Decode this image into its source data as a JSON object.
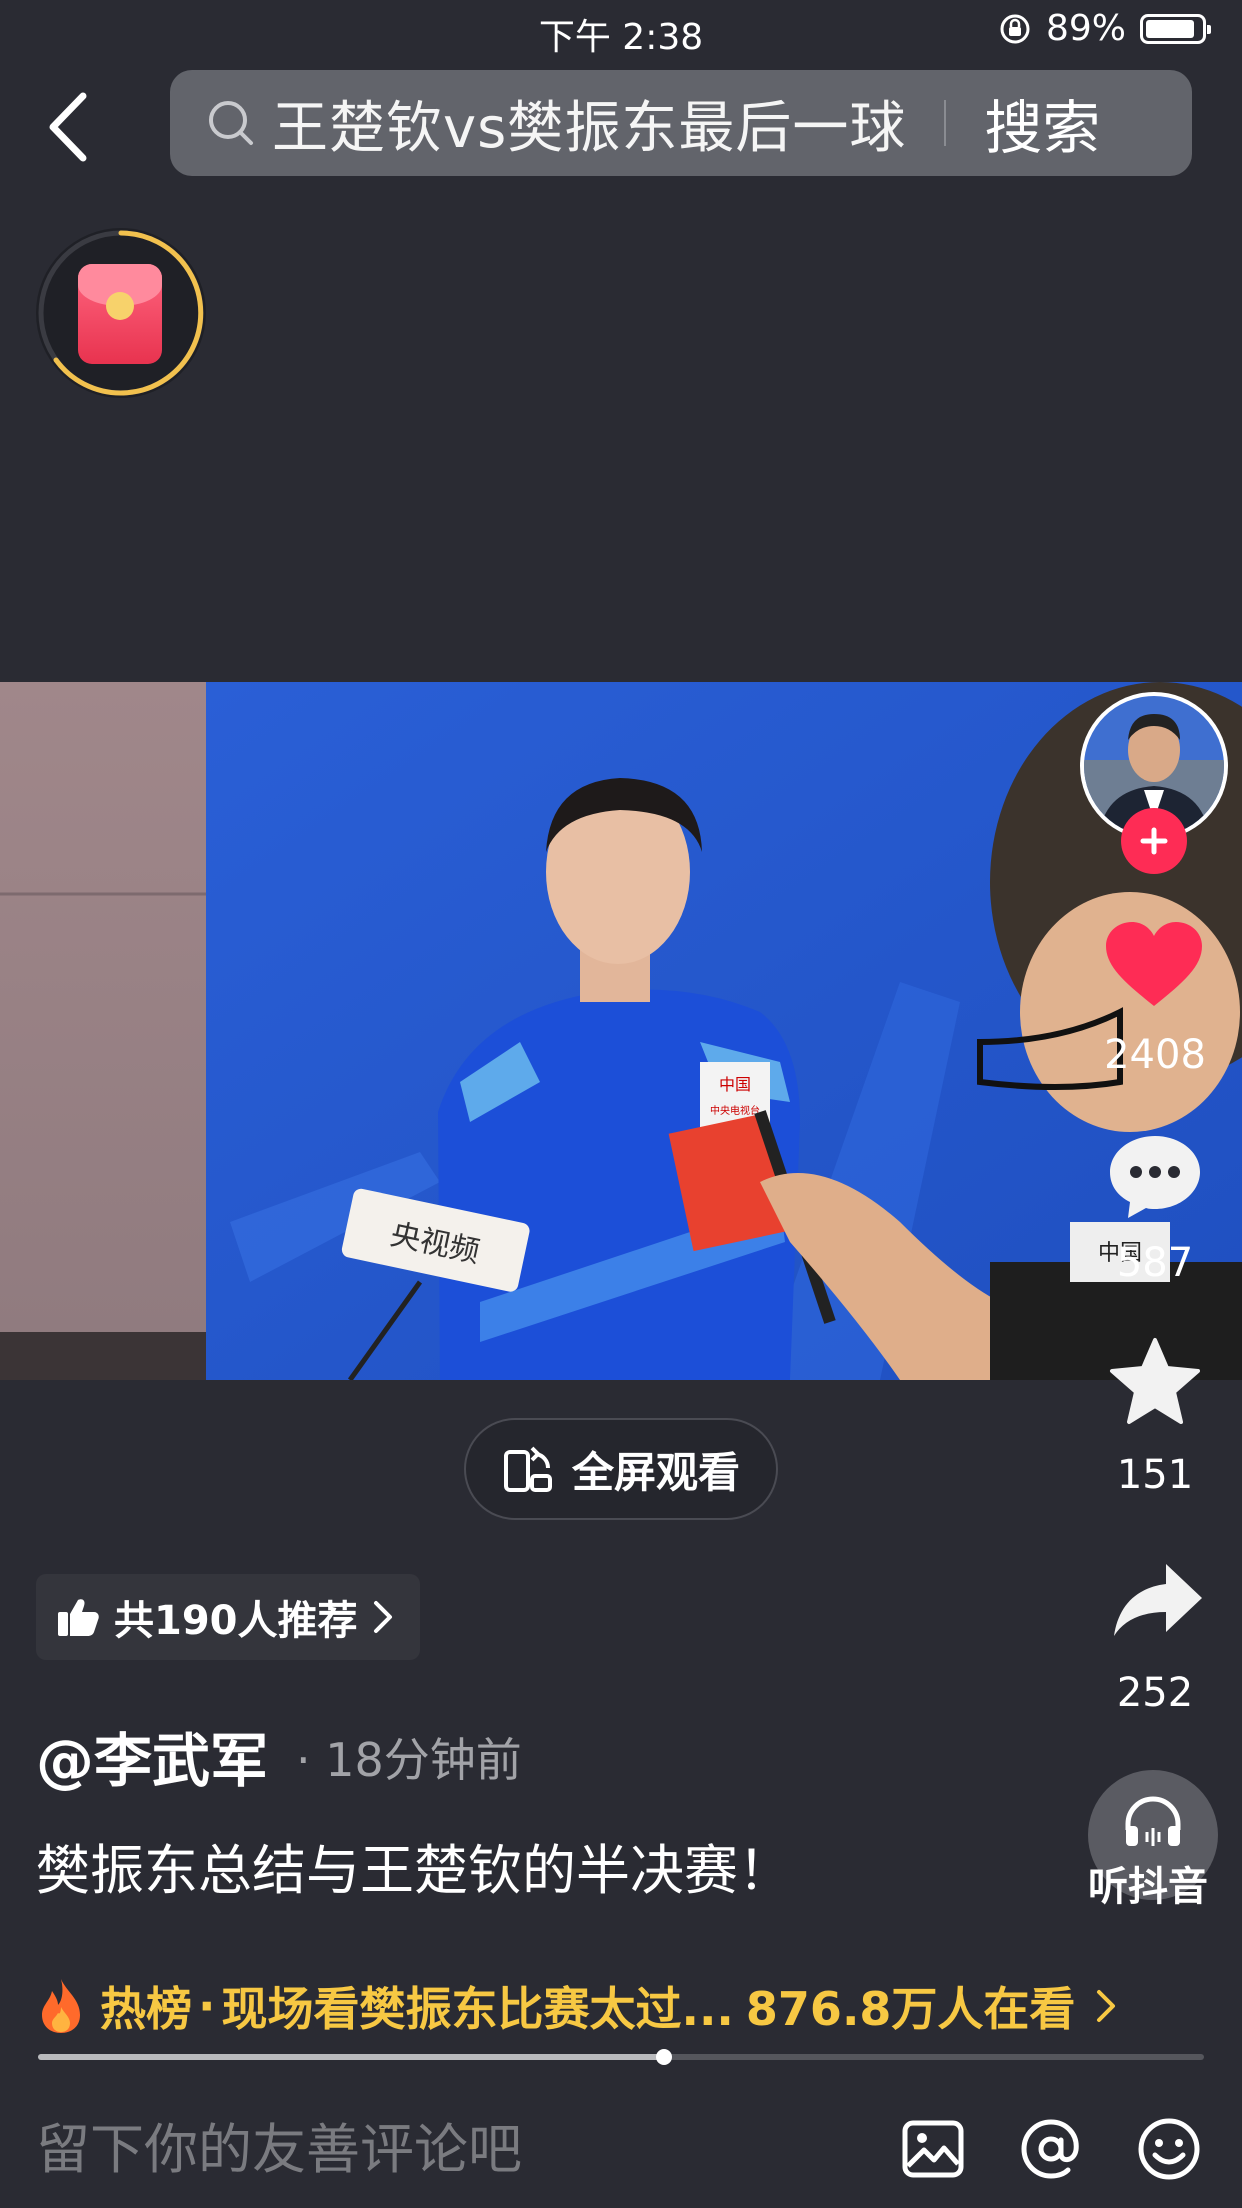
{
  "status_bar": {
    "time": "下午 2:38",
    "battery_percent": "89%",
    "battery_level": 0.89
  },
  "header": {
    "search_query": "王楚钦vs樊振东最后一球",
    "search_button": "搜索"
  },
  "video": {
    "mic_flag_text": "中国",
    "mic_flag_subtext": "中央电视台",
    "sign_text": "央视频",
    "backdrop_text": "中国"
  },
  "actions": {
    "likes": "2408",
    "comments": "587",
    "favorites": "151",
    "shares": "252",
    "listen_label": "听抖音"
  },
  "recommend": {
    "label": "共190人推荐"
  },
  "fullscreen": {
    "label": "全屏观看"
  },
  "post": {
    "author": "@李武军",
    "separator": "·",
    "time_ago": "18分钟前",
    "caption": "樊振东总结与王楚钦的半决赛！"
  },
  "hot": {
    "prefix": "热榜",
    "dot": "·",
    "title": "现场看樊振东比赛太过...",
    "viewers": "876.8万人在看"
  },
  "playback": {
    "progress": 0.537
  },
  "comment": {
    "placeholder": "留下你的友善评论吧"
  },
  "colors": {
    "background": "#2a2b33",
    "accent_red": "#fe2c55",
    "hot_yellow": "#f7c843",
    "ring_gold": "#f2c14e"
  }
}
